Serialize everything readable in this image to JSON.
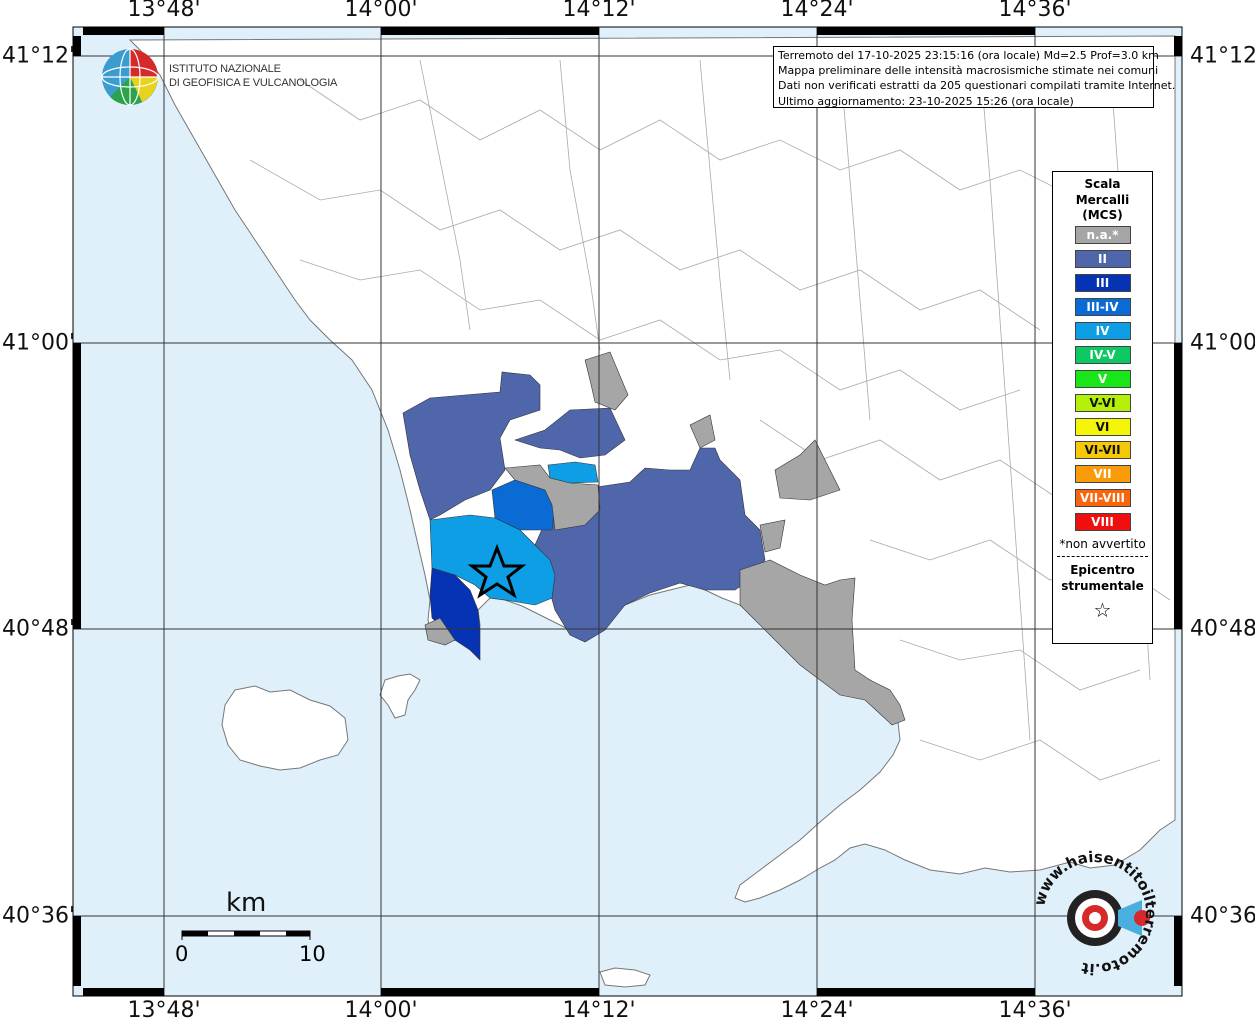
{
  "map": {
    "lon_ticks": [
      "13°48'",
      "14°00'",
      "14°12'",
      "14°24'",
      "14°36'"
    ],
    "lat_ticks": [
      "41°12'",
      "41°00'",
      "40°48'",
      "40°36'"
    ],
    "colors": {
      "sea": "#dff0fb",
      "land": "#ffffff",
      "border": "#999999",
      "grid": "#333333"
    }
  },
  "info": {
    "line1": "Terremoto del 17-10-2025 23:15:16 (ora locale) Md=2.5 Prof=3.0 km",
    "line2": "Mappa preliminare delle intensità macrosismiche stimate nei comuni",
    "line3": "Dati non verificati estratti da 205 questionari compilati tramite Internet.",
    "line4": "Ultimo aggiornamento: 23-10-2025 15:26 (ora locale)"
  },
  "ingv": {
    "line1": "ISTITUTO NAZIONALE",
    "line2": "DI GEOFISICA E VULCANOLOGIA"
  },
  "legend": {
    "title1": "Scala",
    "title2": "Mercalli",
    "title3": "(MCS)",
    "items": [
      {
        "label": "n.a.*",
        "color": "#a6a6a6"
      },
      {
        "label": "II",
        "color": "#4f66ab"
      },
      {
        "label": "III",
        "color": "#0533b4"
      },
      {
        "label": "III-IV",
        "color": "#0a6bd4"
      },
      {
        "label": "IV",
        "color": "#0e9ee6"
      },
      {
        "label": "IV-V",
        "color": "#0ec864"
      },
      {
        "label": "V",
        "color": "#19e619"
      },
      {
        "label": "V-VI",
        "color": "#b4f00a"
      },
      {
        "label": "VI",
        "color": "#f5f50a"
      },
      {
        "label": "VI-VII",
        "color": "#f5c80a"
      },
      {
        "label": "VII",
        "color": "#fa9b0a"
      },
      {
        "label": "VII-VIII",
        "color": "#fa640a"
      },
      {
        "label": "VIII",
        "color": "#f00f0f"
      }
    ],
    "note": "*non avvertito",
    "epi1": "Epicentro",
    "epi2": "strumentale",
    "star": "☆"
  },
  "scalebar": {
    "unit": "km",
    "start": "0",
    "end": "10"
  },
  "hsi": {
    "text": "www.haisentitoilterremoto.it"
  }
}
